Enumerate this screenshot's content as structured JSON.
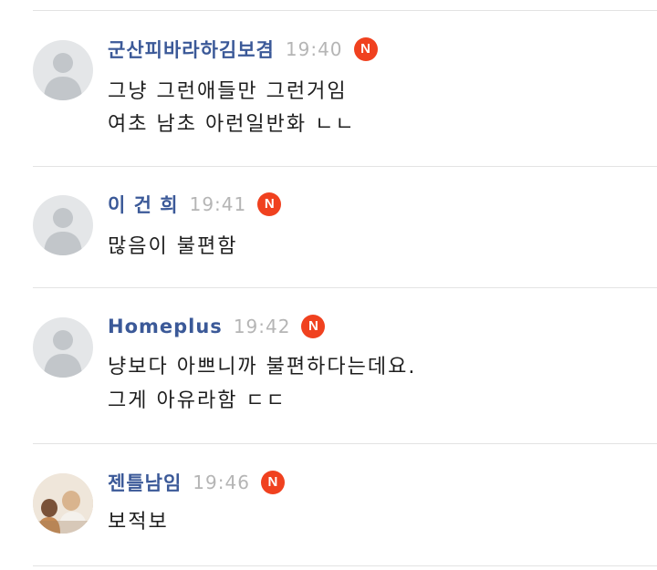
{
  "comments": [
    {
      "author": "군산피바라하김보겸",
      "time": "19:40",
      "badge": "N",
      "lines": [
        "그냥 그런애들만 그런거임",
        "여초 남초 아런일반화 ㄴㄴ"
      ],
      "avatar": "default-avatar-icon"
    },
    {
      "author": "이 건 희",
      "time": "19:41",
      "badge": "N",
      "lines": [
        "많음이 불편함"
      ],
      "avatar": "default-avatar-icon"
    },
    {
      "author": "Homeplus",
      "time": "19:42",
      "badge": "N",
      "lines": [
        "냥보다 아쁘니까 불편하다는데요.",
        "그게 아유라함 ㄷㄷ"
      ],
      "avatar": "default-avatar-icon"
    },
    {
      "author": "젠틀남임",
      "time": "19:46",
      "badge": "N",
      "lines": [
        "보적보"
      ],
      "avatar": "photo-avatar"
    }
  ],
  "colors": {
    "author": "#3b5998",
    "time": "#b5b5b5",
    "badge": "#f0411f",
    "divider": "#e3e3e3"
  }
}
